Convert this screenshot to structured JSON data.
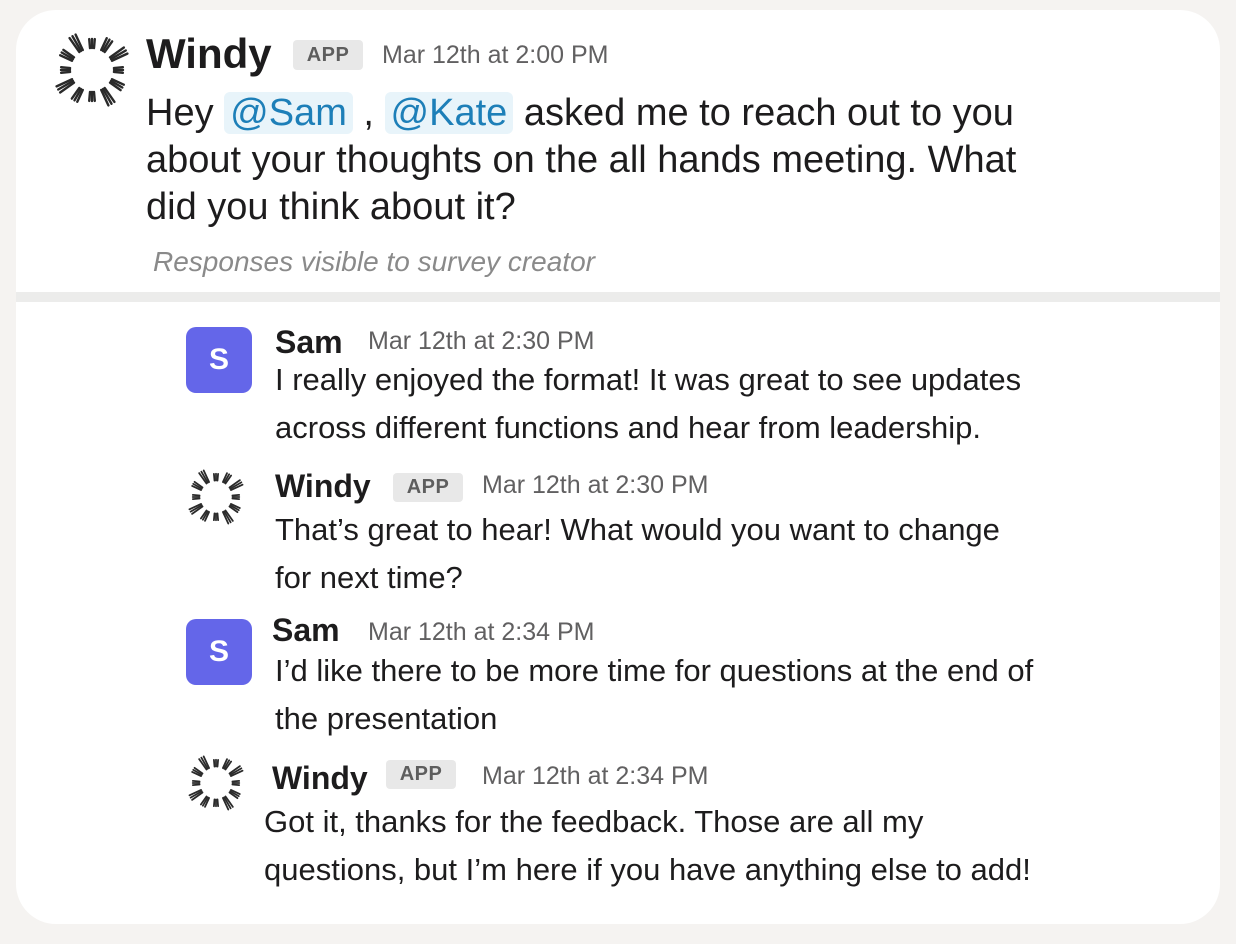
{
  "top_message": {
    "author": "Windy",
    "badge": "APP",
    "timestamp": "Mar 12th at 2:00 PM",
    "text_before": "Hey ",
    "mention_1": "@Sam",
    "separator": " , ",
    "mention_2": "@Kate",
    "text_after": " asked me to reach out to you",
    "line_2": "about your thoughts on the all hands meeting. What",
    "line_3": "did you think about it?",
    "note": "Responses visible to survey creator"
  },
  "replies": [
    {
      "author": "Sam",
      "avatar_letter": "S",
      "timestamp": "Mar 12th at 2:30 PM",
      "lines": [
        "I really enjoyed the format! It was great to see updates",
        "across different functions and hear from leadership."
      ]
    },
    {
      "author": "Windy",
      "badge": "APP",
      "timestamp": "Mar 12th at 2:30 PM",
      "lines": [
        "That’s great to hear! What would you want to change",
        "for next time?"
      ]
    },
    {
      "author": "Sam",
      "avatar_letter": "S",
      "timestamp": "Mar 12th at 2:34 PM",
      "lines": [
        "I’d like there to be more time for questions at the end of",
        "the presentation"
      ]
    },
    {
      "author": "Windy",
      "badge": "APP",
      "timestamp": "Mar 12th at 2:34 PM",
      "lines": [
        "Got it, thanks for the feedback. Those are all my",
        "questions, but I’m here if you have anything else to add!"
      ]
    }
  ],
  "colors": {
    "avatar_bg": "#6466e9",
    "mention_bg": "#e8f4fa",
    "mention_text": "#1d7fb8"
  },
  "icons": {
    "windy_logo": "windy-logo-icon"
  }
}
